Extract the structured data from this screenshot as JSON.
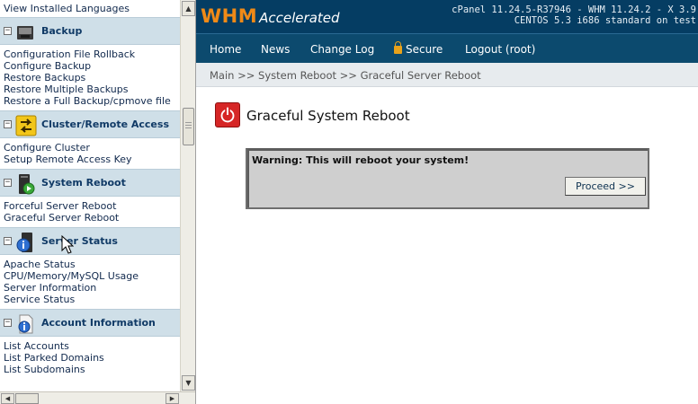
{
  "sidebar": {
    "top_item": "View Installed Languages",
    "sections": [
      {
        "title": "Backup",
        "icon": "backup-icon",
        "links": [
          "Configuration File Rollback",
          "Configure Backup",
          "Restore Backups",
          "Restore Multiple Backups",
          "Restore a Full Backup/cpmove file"
        ]
      },
      {
        "title": "Cluster/Remote Access",
        "icon": "cluster-arrows-icon",
        "links": [
          "Configure Cluster",
          "Setup Remote Access Key"
        ]
      },
      {
        "title": "System Reboot",
        "icon": "reboot-icon",
        "links": [
          "Forceful Server Reboot",
          "Graceful Server Reboot"
        ]
      },
      {
        "title": "Server Status",
        "icon": "server-info-icon",
        "links": [
          "Apache Status",
          "CPU/Memory/MySQL Usage",
          "Server Information",
          "Service Status"
        ]
      },
      {
        "title": "Account Information",
        "icon": "account-info-icon",
        "links": [
          "List Accounts",
          "List Parked Domains",
          "List Subdomains"
        ]
      }
    ]
  },
  "header": {
    "logo_main": "WHM",
    "logo_sub": "Accelerated",
    "version_line1": "cPanel 11.24.5-R37946 - WHM 11.24.2 - X 3.9",
    "version_line2": "CENTOS 5.3 i686 standard on test"
  },
  "menu": {
    "home": "Home",
    "news": "News",
    "changelog": "Change Log",
    "secure": "Secure",
    "logout": "Logout (root)"
  },
  "breadcrumb": {
    "main": "Main",
    "sep": ">>",
    "section": "System Reboot",
    "page": "Graceful Server Reboot"
  },
  "page": {
    "title": "Graceful System Reboot",
    "warning": "Warning: This will reboot your system!",
    "proceed": "Proceed >>"
  },
  "colors": {
    "header_bg": "#053d63",
    "menu_bg": "#0c4a6e",
    "logo_orange": "#f08a17",
    "section_bg": "#cfdfe8",
    "reboot_red": "#d62626"
  }
}
